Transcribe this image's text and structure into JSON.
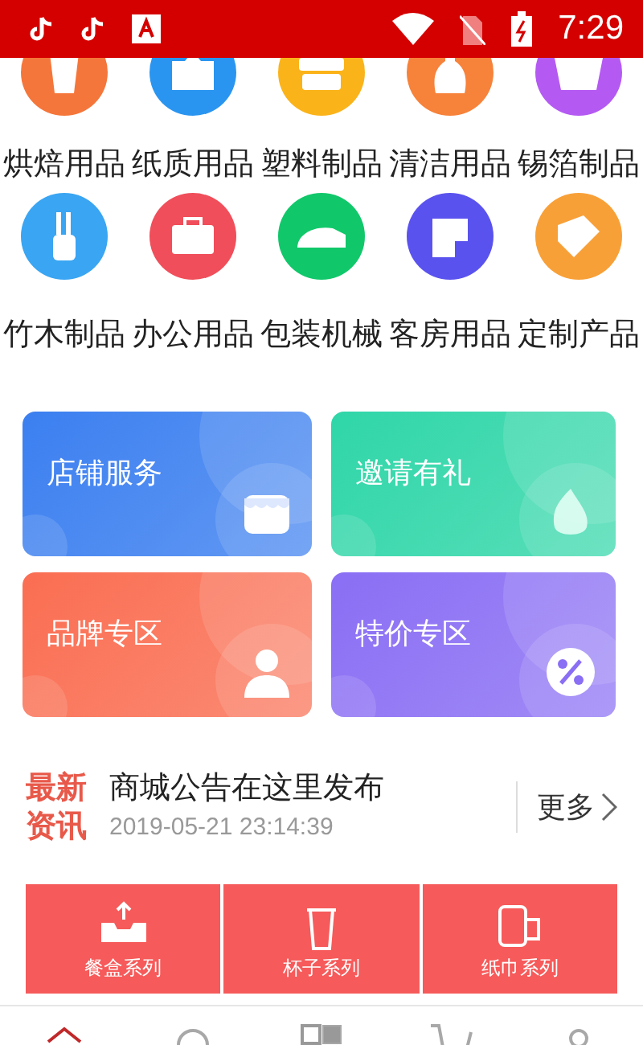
{
  "status_bar": {
    "time": "7:29"
  },
  "categories": [
    {
      "label": "烘焙用品",
      "color": "#f5763a"
    },
    {
      "label": "纸质用品",
      "color": "#2a95f0"
    },
    {
      "label": "塑料制品",
      "color": "#fbb31a"
    },
    {
      "label": "清洁用品",
      "color": "#f7823a"
    },
    {
      "label": "锡箔制品",
      "color": "#b45af2"
    },
    {
      "label": "竹木制品",
      "color": "#3aa5f2"
    },
    {
      "label": "办公用品",
      "color": "#f04e5a"
    },
    {
      "label": "包装机械",
      "color": "#10c86a"
    },
    {
      "label": "客房用品",
      "color": "#5a52ee"
    },
    {
      "label": "定制产品",
      "color": "#f8a038"
    }
  ],
  "promos": [
    {
      "title": "店铺服务",
      "color": "#3b7ff0"
    },
    {
      "title": "邀请有礼",
      "color": "#2fd6a8"
    },
    {
      "title": "品牌专区",
      "color": "#fa6e52"
    },
    {
      "title": "特价专区",
      "color": "#8a6ef4"
    }
  ],
  "news": {
    "badge_top": "最新",
    "badge_bottom": "资讯",
    "headline": "商城公告在这里发布",
    "date": "2019-05-21 23:14:39",
    "more": "更多"
  },
  "series": [
    {
      "label": "餐盒系列"
    },
    {
      "label": "杯子系列"
    },
    {
      "label": "纸巾系列"
    }
  ],
  "tab_bar": [
    {
      "selected": true
    },
    {
      "selected": false
    },
    {
      "selected": false
    },
    {
      "selected": false
    },
    {
      "selected": false
    }
  ]
}
